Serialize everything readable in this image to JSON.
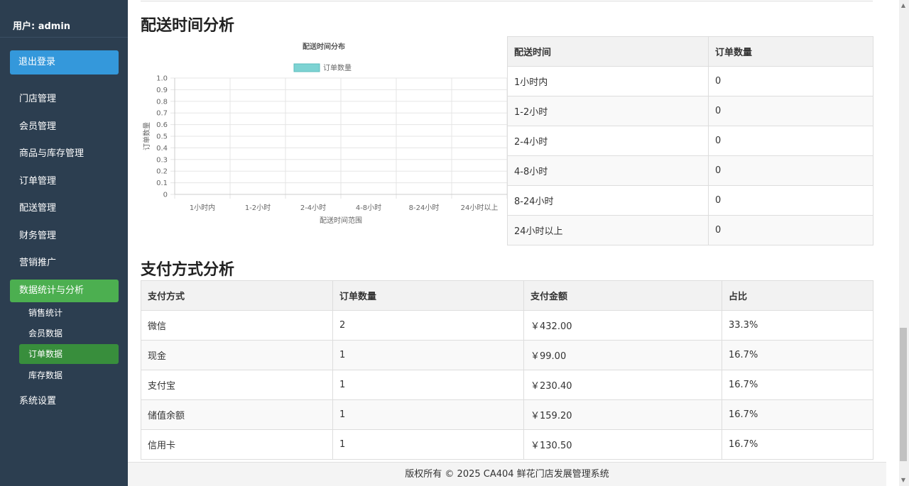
{
  "sidebar": {
    "user_label": "用户: admin",
    "logout_label": "退出登录",
    "items": [
      {
        "label": "门店管理"
      },
      {
        "label": "会员管理"
      },
      {
        "label": "商品与库存管理"
      },
      {
        "label": "订单管理"
      },
      {
        "label": "配送管理"
      },
      {
        "label": "财务管理"
      },
      {
        "label": "营销推广"
      },
      {
        "label": "数据统计与分析"
      },
      {
        "label": "系统设置"
      }
    ],
    "sub_items": [
      {
        "label": "销售统计"
      },
      {
        "label": "会员数据"
      },
      {
        "label": "订单数据"
      },
      {
        "label": "库存数据"
      }
    ],
    "active_item": "数据统计与分析",
    "active_sub_item": "订单数据"
  },
  "delivery_section": {
    "title": "配送时间分析",
    "table": {
      "headers": [
        "配送时间",
        "订单数量"
      ],
      "rows": [
        [
          "1小时内",
          "0"
        ],
        [
          "1-2小时",
          "0"
        ],
        [
          "2-4小时",
          "0"
        ],
        [
          "4-8小时",
          "0"
        ],
        [
          "8-24小时",
          "0"
        ],
        [
          "24小时以上",
          "0"
        ]
      ]
    }
  },
  "chart_data": {
    "type": "bar",
    "title": "配送时间分布",
    "categories": [
      "1小时内",
      "1-2小时",
      "2-4小时",
      "4-8小时",
      "8-24小时",
      "24小时以上"
    ],
    "series": [
      {
        "name": "订单数量",
        "values": [
          0,
          0,
          0,
          0,
          0,
          0
        ]
      }
    ],
    "xlabel": "配送时间范围",
    "ylabel": "订单数量",
    "ylim": [
      0,
      1.0
    ],
    "yticks": [
      "0",
      "0.1",
      "0.2",
      "0.3",
      "0.4",
      "0.5",
      "0.6",
      "0.7",
      "0.8",
      "0.9",
      "1.0"
    ],
    "legend": "top",
    "grid": true,
    "colors": {
      "series": "#7dd3d3"
    }
  },
  "payment_section": {
    "title": "支付方式分析",
    "table": {
      "headers": [
        "支付方式",
        "订单数量",
        "支付金额",
        "占比"
      ],
      "rows": [
        [
          "微信",
          "2",
          "￥432.00",
          "33.3%"
        ],
        [
          "现金",
          "1",
          "￥99.00",
          "16.7%"
        ],
        [
          "支付宝",
          "1",
          "￥230.40",
          "16.7%"
        ],
        [
          "储值余额",
          "1",
          "￥159.20",
          "16.7%"
        ],
        [
          "信用卡",
          "1",
          "￥130.50",
          "16.7%"
        ]
      ]
    }
  },
  "footer": {
    "text": "版权所有 © 2025 CA404 鲜花门店发展管理系统"
  },
  "colors": {
    "sidebar_bg": "#2c3e50",
    "logout_bg": "#3498db",
    "active_bg": "#4caf50",
    "active_sub_bg": "#388e3c"
  }
}
